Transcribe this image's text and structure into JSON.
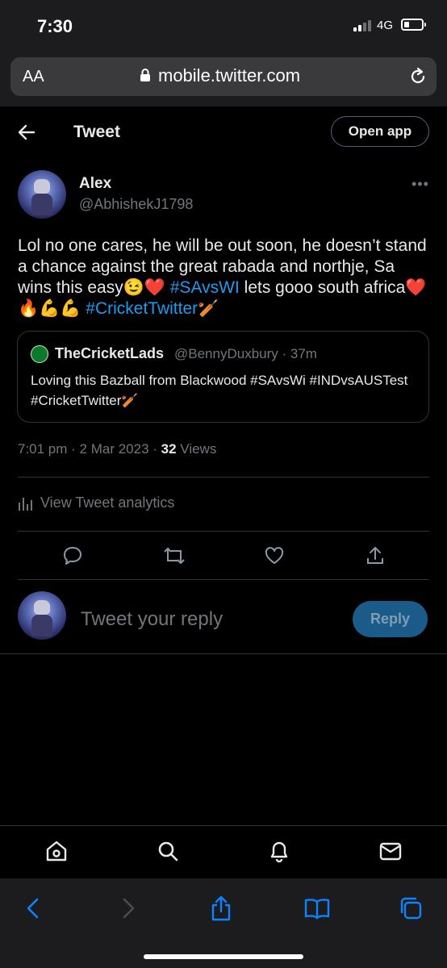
{
  "status_bar": {
    "time": "7:30",
    "network": "4G"
  },
  "browser": {
    "text_size_label": "AA",
    "url": "mobile.twitter.com"
  },
  "header": {
    "title": "Tweet",
    "open_app_label": "Open app"
  },
  "tweet": {
    "author_name": "Alex",
    "author_handle": "@AbhishekJ1798",
    "more_label": "•••",
    "text_part1": "Lol no one cares, he will be out soon, he doesn’t stand a chance against the great rabada and northje, Sa wins this easy😉❤️ ",
    "hashtag1": "#SAvsWI",
    "text_part2": " lets gooo south africa❤️🔥💪💪 ",
    "hashtag2": "#CricketTwitter",
    "emoji_end": "🏏",
    "timestamp": "7:01 pm · 2 Mar 2023 · ",
    "views_count": "32",
    "views_label": " Views"
  },
  "quoted_tweet": {
    "author_name": "TheCricketLads",
    "author_handle": "@BennyDuxbury · 37m",
    "text": "Loving this Bazball from Blackwood #SAvsWi #INDvsAUSTest #CricketTwitter🏏"
  },
  "analytics_label": "View Tweet analytics",
  "reply": {
    "placeholder": "Tweet your reply",
    "button_label": "Reply"
  },
  "icons": {
    "back": "arrow-left-icon",
    "reply": "comment-icon",
    "retweet": "retweet-icon",
    "like": "heart-icon",
    "share": "share-icon",
    "home": "home-icon",
    "search": "search-icon",
    "notifications": "bell-icon",
    "messages": "mail-icon"
  },
  "colors": {
    "accent": "#1d9bf0",
    "background": "#000000",
    "muted": "#71767b"
  }
}
